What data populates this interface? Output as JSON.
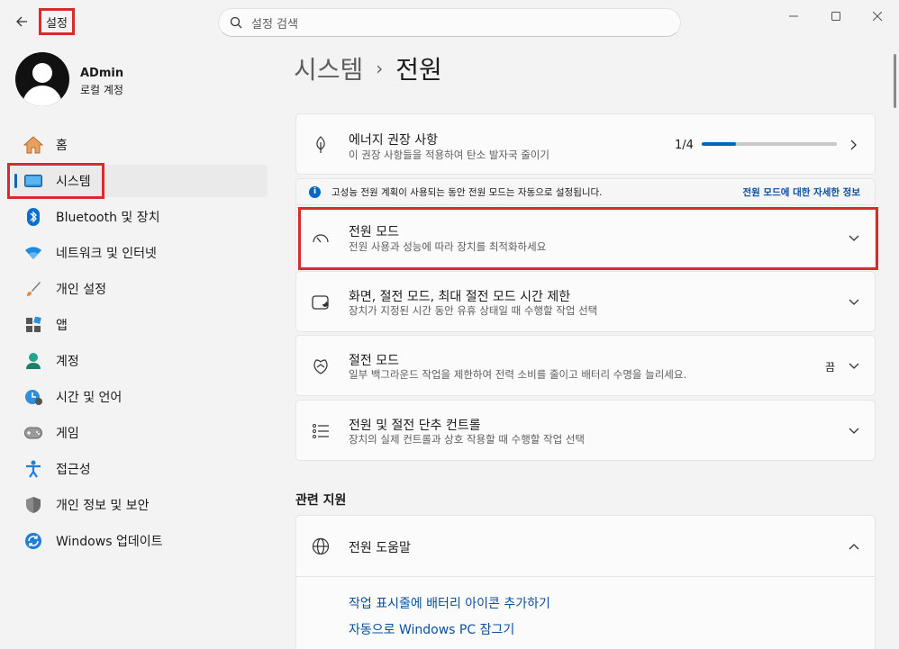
{
  "window": {
    "app_title": "설정",
    "search_placeholder": "설정 검색"
  },
  "profile": {
    "name": "ADmin",
    "account_type": "로컬 계정"
  },
  "sidebar": {
    "items": [
      {
        "label": "홈",
        "icon": "home-icon"
      },
      {
        "label": "시스템",
        "icon": "system-icon",
        "selected": true
      },
      {
        "label": "Bluetooth 및 장치",
        "icon": "bluetooth-icon"
      },
      {
        "label": "네트워크 및 인터넷",
        "icon": "wifi-icon"
      },
      {
        "label": "개인 설정",
        "icon": "brush-icon"
      },
      {
        "label": "앱",
        "icon": "apps-icon"
      },
      {
        "label": "계정",
        "icon": "account-icon"
      },
      {
        "label": "시간 및 언어",
        "icon": "time-language-icon"
      },
      {
        "label": "게임",
        "icon": "gamepad-icon"
      },
      {
        "label": "접근성",
        "icon": "accessibility-icon"
      },
      {
        "label": "개인 정보 및 보안",
        "icon": "shield-icon"
      },
      {
        "label": "Windows 업데이트",
        "icon": "update-icon"
      }
    ]
  },
  "breadcrumb": {
    "parent": "시스템",
    "separator": "›",
    "current": "전원"
  },
  "cards": {
    "energy": {
      "title": "에너지 권장 사항",
      "subtitle": "이 권장 사항들을 적용하여 탄소 발자국 줄이기",
      "progress_text": "1/4",
      "progress_fraction": 0.25
    },
    "info_bar": {
      "text": "고성능 전원 계획이 사용되는 동안 전원 모드는 자동으로 설정됩니다.",
      "link": "전원 모드에 대한 자세한 정보"
    },
    "power_mode": {
      "title": "전원 모드",
      "subtitle": "전원 사용과 성능에 따라 장치를 최적화하세요"
    },
    "screen_sleep": {
      "title": "화면, 절전 모드, 최대 절전 모드 시간 제한",
      "subtitle": "장치가 지정된 시간 동안 유휴 상태일 때 수행할 작업 선택"
    },
    "energy_saver": {
      "title": "절전 모드",
      "subtitle": "일부 백그라운드 작업을 제한하여 전력 소비를 줄이고 배터리 수명을 늘리세요.",
      "value": "끔"
    },
    "power_controls": {
      "title": "전원 및 절전 단추 컨트롤",
      "subtitle": "장치의 실제 컨트롤과 상호 작용할 때 수행할 작업 선택"
    }
  },
  "related": {
    "section_title": "관련 지원",
    "help_title": "전원 도움말",
    "links": [
      "작업 표시줄에 배터리 아이콘 추가하기",
      "자동으로 Windows PC 잠그기"
    ]
  },
  "colors": {
    "accent": "#0067c0",
    "highlight_border": "#d92b2b"
  }
}
